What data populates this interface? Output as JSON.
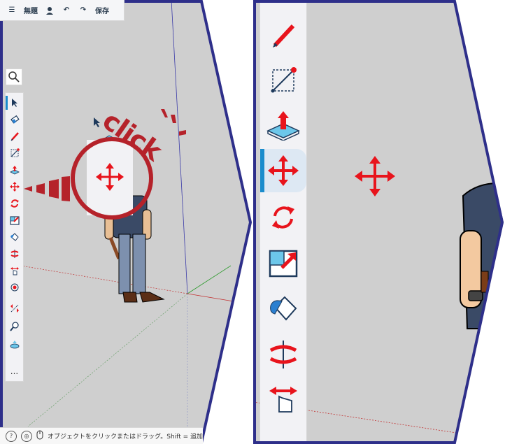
{
  "topbar": {
    "menu_icon": "hamburger-menu-icon",
    "title": "無題",
    "user_icon": "user-add-icon",
    "undo_icon": "undo-icon",
    "redo_icon": "redo-icon",
    "save_label": "保存"
  },
  "annotation": {
    "click_text": "click"
  },
  "statusbar": {
    "help_icon": "?",
    "globe_icon": "globe-icon",
    "mouse_icon": "mouse-icon",
    "message": "オブジェクトをクリックまたはドラッグ。Shift = 追加"
  },
  "toolbar": {
    "items": [
      {
        "name": "select-tool",
        "icon": "arrow-pointer-icon"
      },
      {
        "name": "eraser-tool",
        "icon": "eraser-icon"
      },
      {
        "name": "pencil-tool",
        "icon": "pencil-icon"
      },
      {
        "name": "line-tool",
        "icon": "line-icon"
      },
      {
        "name": "push-pull-tool",
        "icon": "push-pull-icon"
      },
      {
        "name": "move-tool",
        "icon": "move-arrows-icon"
      },
      {
        "name": "rotate-tool",
        "icon": "rotate-icon"
      },
      {
        "name": "scale-tool",
        "icon": "scale-icon"
      },
      {
        "name": "paint-bucket-tool",
        "icon": "paint-bucket-icon"
      },
      {
        "name": "orbit-tool",
        "icon": "orbit-icon"
      },
      {
        "name": "pan-tool",
        "icon": "pan-hand-icon"
      },
      {
        "name": "zoom-extent-tool",
        "icon": "target-icon"
      },
      {
        "name": "tape-measure-tool",
        "icon": "tape-measure-icon"
      },
      {
        "name": "zoom-tool",
        "icon": "magnifier-icon"
      },
      {
        "name": "section-tool",
        "icon": "section-plane-icon"
      },
      {
        "name": "more-tools",
        "label": "..."
      }
    ]
  },
  "colors": {
    "accent": "#1a8ccc",
    "tool_red": "#e8141c",
    "annotation_red": "#b5222a",
    "frame_navy": "#2e2f8a",
    "viewport_gray": "#cfcfcf"
  }
}
